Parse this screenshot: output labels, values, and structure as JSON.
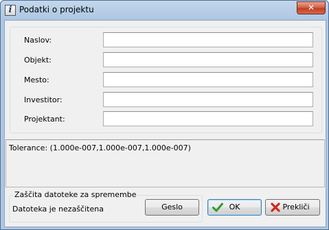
{
  "window": {
    "title": "Podatki o projektu",
    "close_glyph": "✕",
    "app_icon_letter": "i"
  },
  "fields": [
    {
      "label": "Naslov:",
      "value": ""
    },
    {
      "label": "Objekt:",
      "value": ""
    },
    {
      "label": "Mesto:",
      "value": ""
    },
    {
      "label": "Investitor:",
      "value": ""
    },
    {
      "label": "Projektant:",
      "value": ""
    }
  ],
  "tolerance_text": "Tolerance: (1.000e-007,1.000e-007,1.000e-007)",
  "protection": {
    "group_title": "Zaščita datoteke za spremembe",
    "status": "Datoteka je nezaščitena",
    "password_button": "Geslo"
  },
  "buttons": {
    "ok": "OK",
    "cancel": "Prekliči"
  },
  "icons": {
    "ok": "checkmark-icon",
    "cancel": "red-x-icon"
  },
  "colors": {
    "ok_icon": "#2e9a2e",
    "cancel_icon": "#d0281e",
    "default_button_border": "#3c7fb1"
  }
}
